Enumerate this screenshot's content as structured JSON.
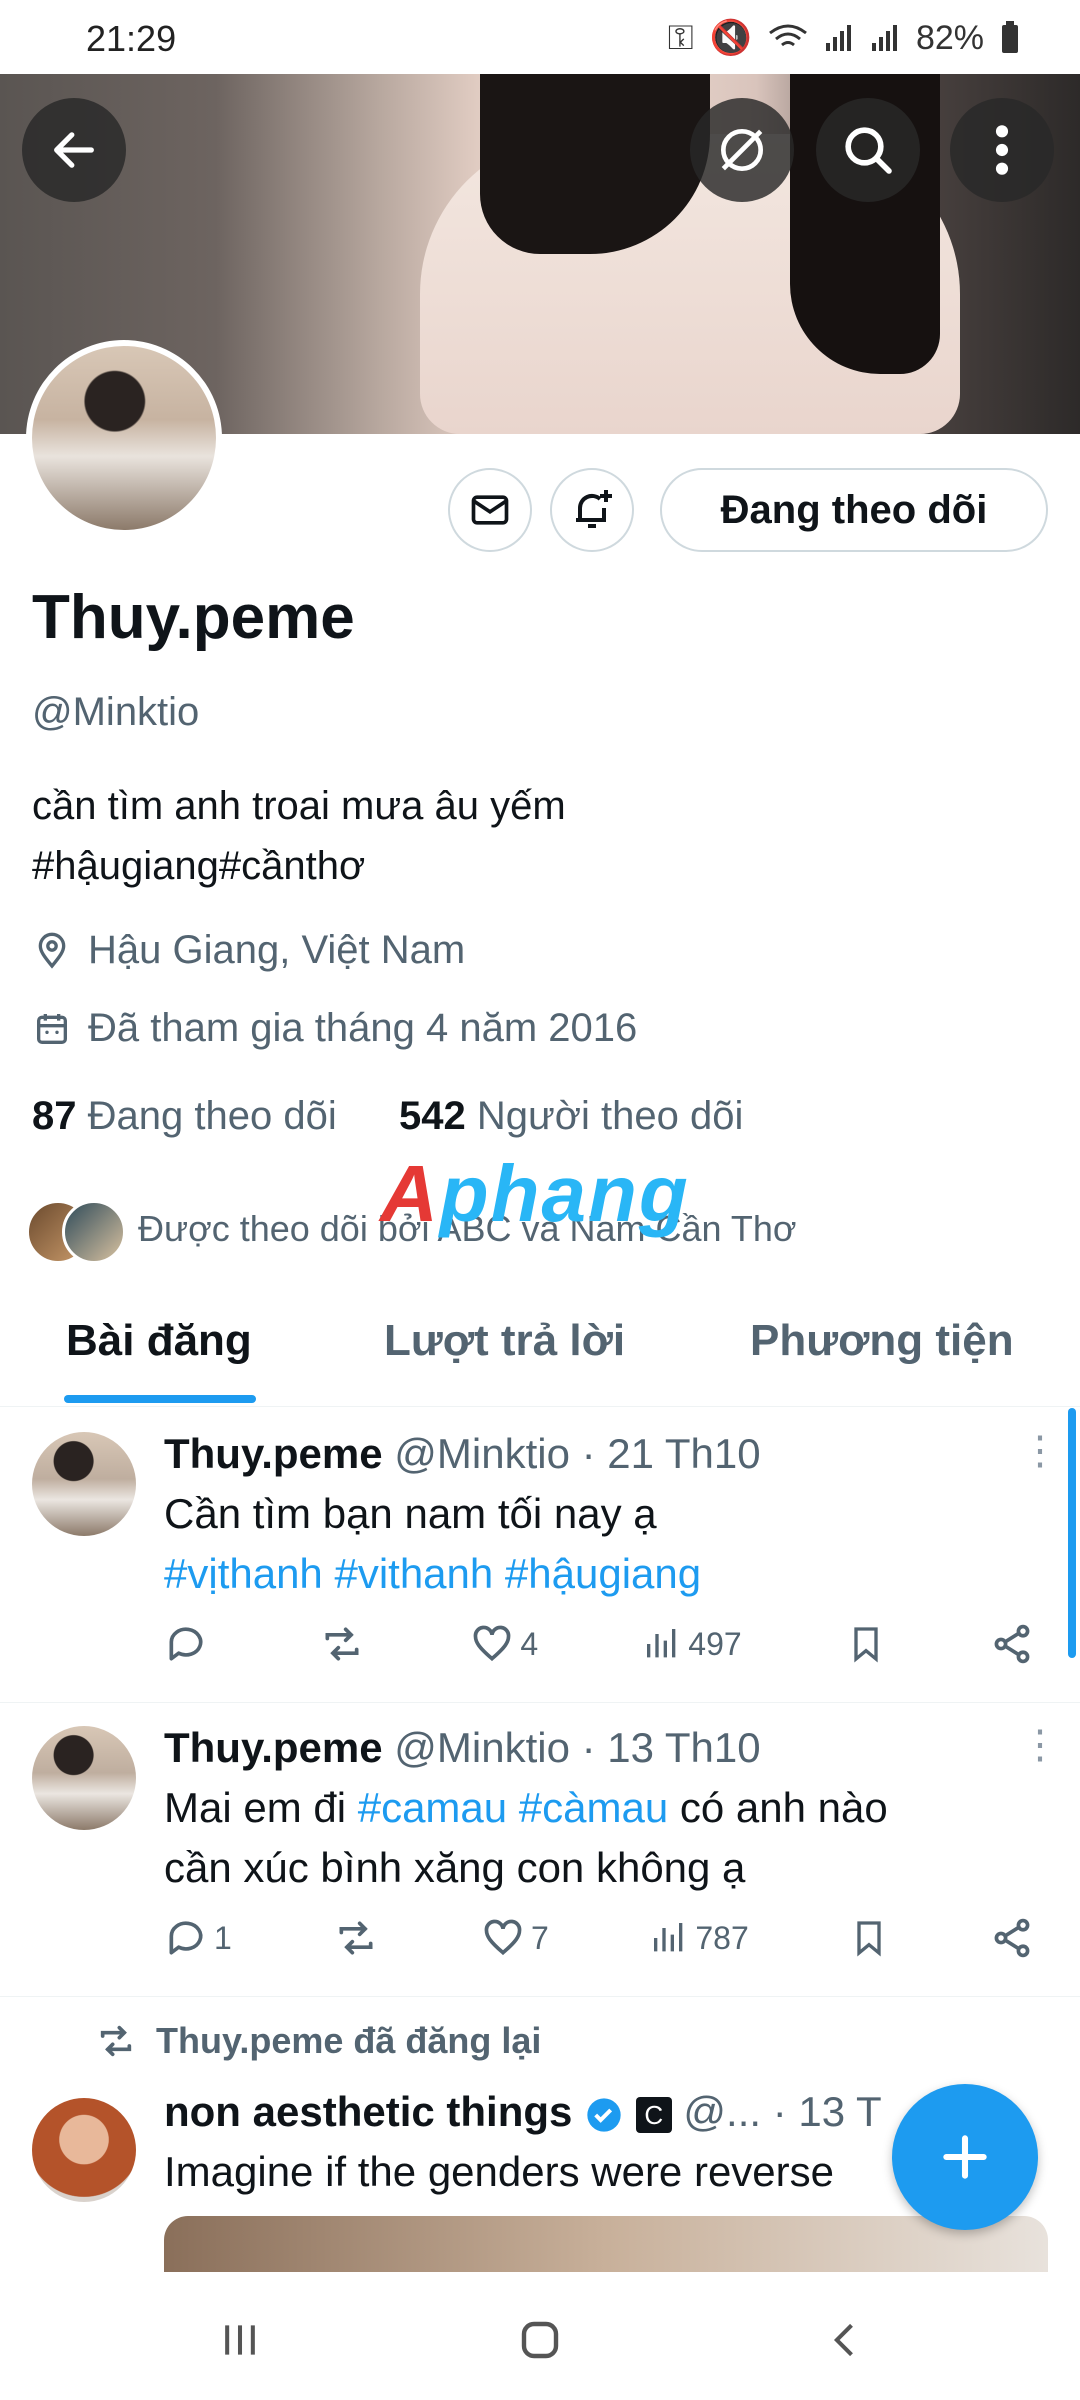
{
  "status_bar": {
    "time": "21:29",
    "battery": "82%"
  },
  "header": {
    "back_icon": "arrow-left-icon",
    "grok_icon": "grok-icon",
    "search_icon": "search-icon",
    "more_icon": "more-vertical-icon"
  },
  "profile": {
    "name": "Thuy.peme",
    "handle": "@Minktio",
    "bio_line1": "cần tìm anh troai mưa âu yếm",
    "bio_line2": "#hậugiang#cầnthơ",
    "location": "Hậu Giang, Việt Nam",
    "joined": "Đã tham gia tháng 4 năm 2016",
    "following_count": "87",
    "following_label": "Đang theo dõi",
    "followers_count": "542",
    "followers_label": "Người theo dõi",
    "followed_by": "Được theo dõi bởi ABC và Nam Cần Thơ",
    "follow_button": "Đang theo dõi",
    "watermark": "Aphang"
  },
  "tabs": [
    "Bài đăng",
    "Lượt trả lời",
    "Phương tiện"
  ],
  "tweets": [
    {
      "name": "Thuy.peme",
      "handle": "@Minktio",
      "date": "· 21 Th10",
      "text_plain": "Cần tìm bạn nam tối nay ạ",
      "tags": "#vịthanh #vithanh #hậugiang",
      "replies": "",
      "likes": "4",
      "views": "497"
    },
    {
      "name": "Thuy.peme",
      "handle": "@Minktio",
      "date": "· 13 Th10",
      "text_a": "Mai em đi ",
      "tags": "#camau #càmau",
      "text_b": " có anh nào",
      "text_line2": "cần xúc bình xăng con không ạ",
      "replies": "1",
      "likes": "7",
      "views": "787"
    }
  ],
  "repost": {
    "label": "Thuy.peme đã đăng lại",
    "name": "non aesthetic things",
    "handle": "@...",
    "date": "· 13 T",
    "text": "Imagine if the genders were reverse"
  },
  "colors": {
    "accent": "#1d9bf0",
    "text": "#0f1419",
    "secondary": "#536471"
  }
}
